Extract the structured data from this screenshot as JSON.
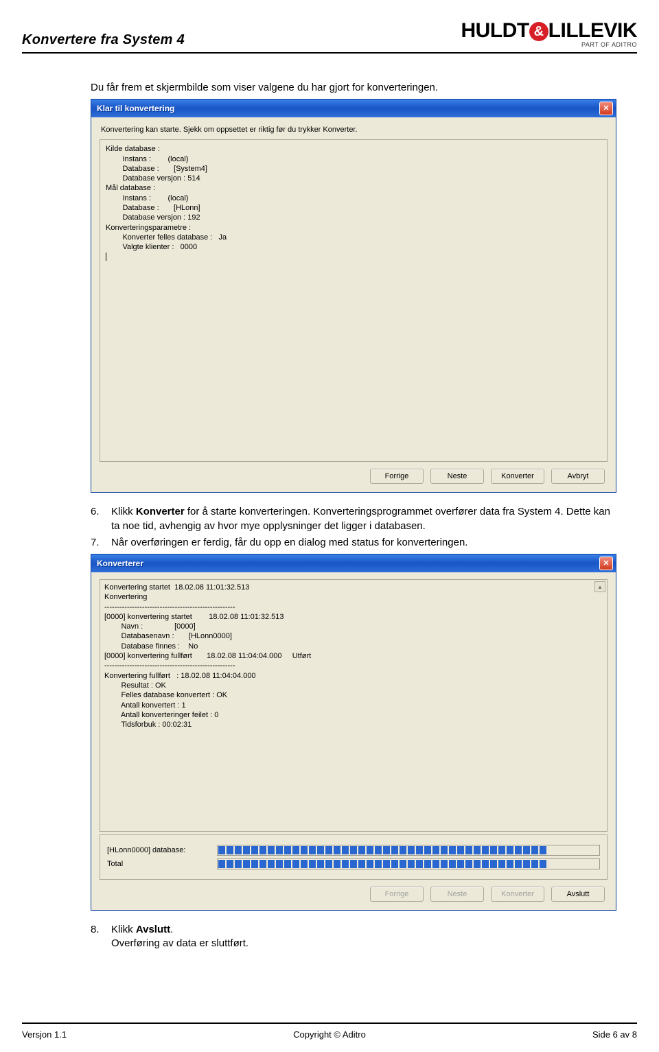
{
  "doc": {
    "title": "Konvertere fra System 4",
    "logo": {
      "brand1": "HULDT",
      "brand2": "LILLEVIK",
      "sub": "PART OF ADITRO"
    }
  },
  "intro": "Du får frem et skjermbilde som viser valgene du har gjort for konverteringen.",
  "win1": {
    "title": "Klar til konvertering",
    "hint": "Konvertering kan starte. Sjekk om oppsettet er riktig før du trykker Konverter.",
    "body": "Kilde database :\n        Instans :        (local)\n        Database :       [System4]\n        Database versjon : 514\nMål database :\n        Instans :        (local)\n        Database :       [HLonn]\n        Database versjon : 192\nKonverteringsparametre :\n        Konverter felles database :   Ja\n        Valgte klienter :   0000",
    "buttons": {
      "prev": "Forrige",
      "next": "Neste",
      "convert": "Konverter",
      "cancel": "Avbryt"
    }
  },
  "step6a": "Klikk ",
  "step6b": "Konverter",
  "step6c": " for å starte konverteringen. Konverteringsprogrammet overfører data fra System 4. Dette kan ta noe tid, avhengig av hvor mye opplysninger det ligger i databasen.",
  "step7": "Når overføringen er ferdig, får du opp en dialog med status for konverteringen.",
  "win2": {
    "title": "Konverterer",
    "log": "Konvertering startet  18.02.08 11:01:32.513\nKonvertering\n----------------------------------------------------\n[0000] konvertering startet        18.02.08 11:01:32.513\n        Navn :               [0000]\n        Databasenavn :       [HLonn0000]\n        Database finnes :    No\n[0000] konvertering fullført       18.02.08 11:04:04.000     Utført\n----------------------------------------------------\nKonvertering fullført   : 18.02.08 11:04:04.000\n        Resultat : OK\n        Felles database konvertert : OK\n        Antall konvertert : 1\n        Antall konverteringer feilet : 0\n        Tidsforbuk : 00:02:31",
    "prog1_label": "[HLonn0000] database:",
    "prog2_label": "Total",
    "buttons": {
      "prev": "Forrige",
      "next": "Neste",
      "convert": "Konverter",
      "finish": "Avslutt"
    }
  },
  "step8a": "Klikk ",
  "step8b": "Avslutt",
  "step8c": ".",
  "step8line2": "Overføring av data er sluttført.",
  "footer": {
    "left": "Versjon 1.1",
    "center": "Copyright © Aditro",
    "right": "Side 6 av 8"
  }
}
